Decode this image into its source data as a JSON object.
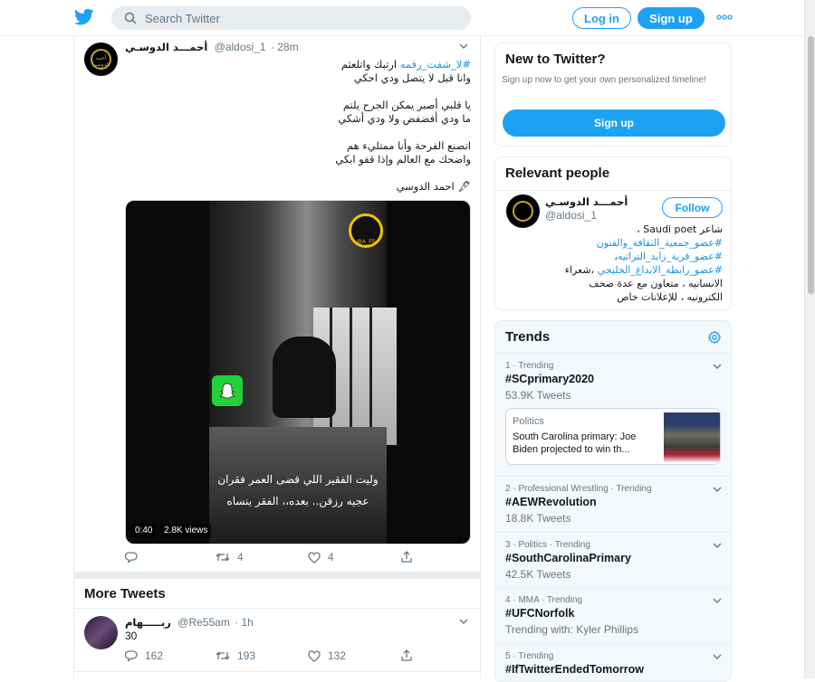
{
  "header": {
    "search_placeholder": "Search Twitter",
    "login_label": "Log in",
    "signup_label": "Sign up",
    "more_icon": "more-dots-icon",
    "logo_icon": "twitter-bird-icon",
    "brand_color": "#1da1f2"
  },
  "tweet": {
    "author_name": "أحمـــد الدوسـي",
    "handle": "@aldosi_1",
    "time": "· 28m",
    "avatar_text": "أحمد الدوسي",
    "hashtag": "#لا_شفت_رقمه",
    "line1_rest": "ارتبك واتلعثم",
    "line2": "وانا قبل لا يتصل ودي احكي",
    "line3": "يا قلبي أصبر يمكن الجرح يلتم",
    "line4": "ما ودي أفضفض ولا ودي أشكي",
    "line5": "اتصنع الفرحة وأنا ممتليء هم",
    "line6": "واضحك مع العالم وإذا قفو ابكي",
    "signature": "🖋 احمد الدوسي",
    "video": {
      "caption_line1": "وليت الفقير اللي قضى العمر فقران",
      "caption_line2": "عجيه رزقن.. بعده،، الفقر ينساه",
      "duration": "0:40",
      "views": "2.8K views",
      "snap_badge_text": "@A_F5"
    },
    "actions": {
      "reply_count": "",
      "retweet_count": "4",
      "like_count": "4"
    }
  },
  "more_tweets": {
    "title": "More Tweets",
    "tweet": {
      "author_name": "ربـــــهام",
      "handle": "@Re55am",
      "time": "· 1h",
      "text": "30",
      "reply_count": "162",
      "retweet_count": "193",
      "like_count": "132"
    }
  },
  "new_to_twitter": {
    "title": "New to Twitter?",
    "subtitle": "Sign up now to get your own personalized timeline!",
    "button": "Sign up"
  },
  "relevant_people": {
    "title": "Relevant people",
    "name": "أحمـــد الدوسـي",
    "handle": "@aldosi_1",
    "follow_label": "Follow",
    "bio_line1": "شاعر Saudi poet ،",
    "bio_tag1": "#عضو_جمعية_الثقافة_والفنون",
    "bio_tag2": "#عضو_قرية_زايد_التراثيه",
    "bio_tag2_suffix": "،",
    "bio_tag3": "#عضو_رابطة_الابداع_الخليجي",
    "bio_tag3_suffix": "،شعراء",
    "bio_line5": "الانسانيه ، متعاون مع عدة صحف",
    "bio_line6": "الكترونيه ، للإعلانات خاص"
  },
  "trends": {
    "title": "Trends",
    "items": [
      {
        "meta": "1 · Trending",
        "tag": "#SCprimary2020",
        "count": "53.9K Tweets"
      },
      {
        "meta": "2 · Professional Wrestling · Trending",
        "tag": "#AEWRevolution",
        "count": "18.8K Tweets"
      },
      {
        "meta": "3 · Politics · Trending",
        "tag": "#SouthCarolinaPrimary",
        "count": "42.5K Tweets"
      },
      {
        "meta": "4 · MMA · Trending",
        "tag": "#UFCNorfolk",
        "count": "Trending with: Kyler Phillips"
      },
      {
        "meta": "5 · Trending",
        "tag": "#IfTwitterEndedTomorrow",
        "count": ""
      }
    ],
    "card": {
      "category": "Politics",
      "headline": "South Carolina primary: Joe Biden projected to win th..."
    }
  }
}
